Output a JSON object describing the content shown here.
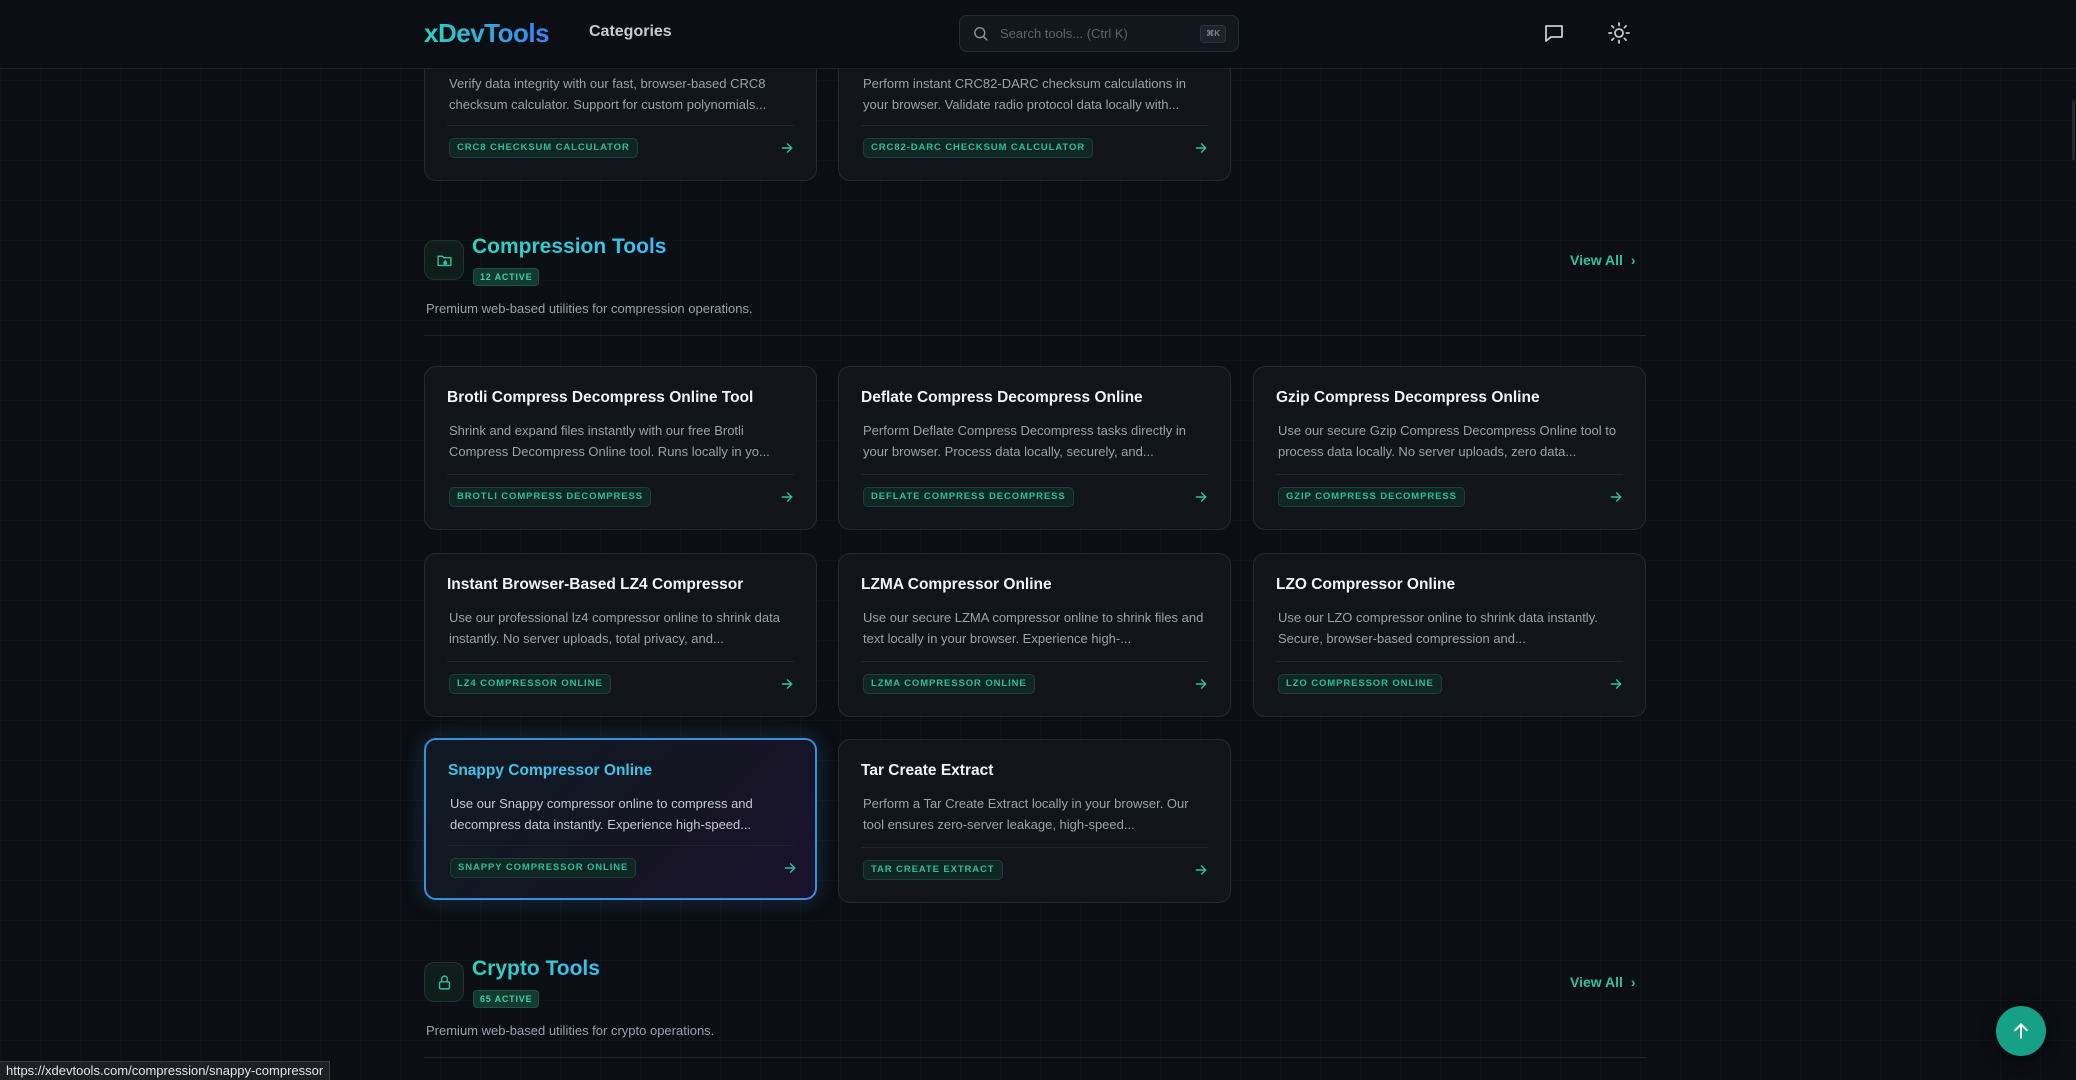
{
  "header": {
    "logo": "xDevTools",
    "nav_categories": "Categories",
    "search_placeholder": "Search tools... (Ctrl K)",
    "search_shortcut": "⌘K",
    "icons": [
      "message-square-icon",
      "sun-icon"
    ]
  },
  "top_cards": [
    {
      "description": "Verify data integrity with our fast, browser-based CRC8 checksum calculator. Support for custom polynomials...",
      "tag": "CRC8 CHECKSUM CALCULATOR"
    },
    {
      "description": "Perform instant CRC82-DARC checksum calculations in your browser. Validate radio protocol data locally with...",
      "tag": "CRC82-DARC CHECKSUM CALCULATOR"
    }
  ],
  "compression": {
    "title": "Compression Tools",
    "badge": "12 ACTIVE",
    "description": "Premium web-based utilities for compression operations.",
    "view_all": "View All",
    "icon": "folder-archive-icon",
    "cards": [
      {
        "title": "Brotli Compress Decompress Online Tool",
        "description": "Shrink and expand files instantly with our free Brotli Compress Decompress Online tool. Runs locally in yo...",
        "tag": "BROTLI COMPRESS DECOMPRESS"
      },
      {
        "title": "Deflate Compress Decompress Online",
        "description": "Perform Deflate Compress Decompress tasks directly in your browser. Process data locally, securely, and...",
        "tag": "DEFLATE COMPRESS DECOMPRESS"
      },
      {
        "title": "Gzip Compress Decompress Online",
        "description": "Use our secure Gzip Compress Decompress Online tool to process data locally. No server uploads, zero data...",
        "tag": "GZIP COMPRESS DECOMPRESS"
      },
      {
        "title": "Instant Browser-Based LZ4 Compressor",
        "description": "Use our professional lz4 compressor online to shrink data instantly. No server uploads, total privacy, and...",
        "tag": "LZ4 COMPRESSOR ONLINE"
      },
      {
        "title": "LZMA Compressor Online",
        "description": "Use our secure LZMA compressor online to shrink files and text locally in your browser. Experience high-...",
        "tag": "LZMA COMPRESSOR ONLINE"
      },
      {
        "title": "LZO Compressor Online",
        "description": "Use our LZO compressor online to shrink data instantly. Secure, browser-based compression and...",
        "tag": "LZO COMPRESSOR ONLINE"
      },
      {
        "title": "Snappy Compressor Online",
        "description": "Use our Snappy compressor online to compress and decompress data instantly. Experience high-speed...",
        "tag": "SNAPPY COMPRESSOR ONLINE"
      },
      {
        "title": "Tar Create Extract",
        "description": "Perform a Tar Create Extract locally in your browser. Our tool ensures zero-server leakage, high-speed...",
        "tag": "TAR CREATE EXTRACT"
      }
    ]
  },
  "crypto": {
    "title": "Crypto Tools",
    "badge": "65 ACTIVE",
    "description": "Premium web-based utilities for crypto operations.",
    "view_all": "View All",
    "icon": "lock-icon"
  },
  "status_url": "https://xdevtools.com/compression/snappy-compressor",
  "colors": {
    "accent": "#2dd4bf",
    "background": "#0b0e13",
    "card_background": "#11151b",
    "active_border": "#3b8fd8",
    "tag_text": "#2bbf9c",
    "scroll_top_button": "#16a085"
  }
}
